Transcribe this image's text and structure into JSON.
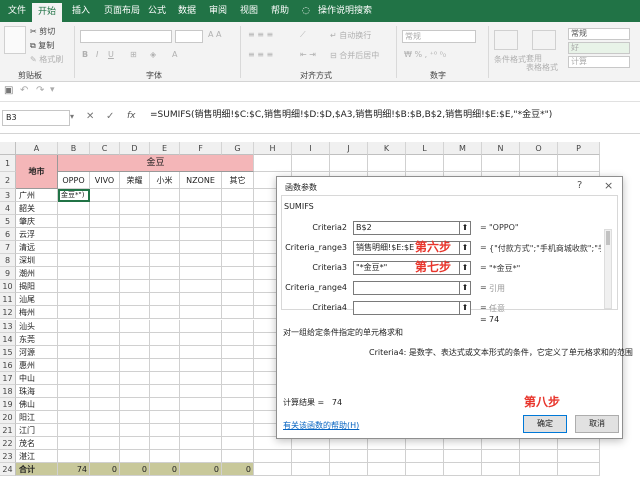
{
  "tabs": [
    "文件",
    "开始",
    "插入",
    "页面布局",
    "公式",
    "数据",
    "审阅",
    "视图",
    "帮助"
  ],
  "tell_me": "操作说明搜索",
  "ribbon": {
    "clipboard": {
      "cut": "剪切",
      "copy": "复制",
      "format_painter": "格式刷",
      "label": "剪贴板"
    },
    "font": {
      "label": "字体"
    },
    "align": {
      "wrap": "自动换行",
      "merge": "合并后居中",
      "label": "对齐方式"
    },
    "number": {
      "format": "常规",
      "label": "数字"
    },
    "styles": {
      "cond": "条件格式",
      "table": "套用\n表格格式",
      "normal": "常规",
      "good": "好",
      "calc": "计算"
    }
  },
  "formula_bar": {
    "name_box": "B3",
    "formula": "=SUMIFS(销售明细!$C:$C,销售明细!$D:$D,$A3,销售明细!$B:$B,B$2,销售明细!$E:$E,\"*金豆*\")"
  },
  "sheet": {
    "columns": [
      "A",
      "B",
      "C",
      "D",
      "E",
      "F",
      "G",
      "H",
      "I",
      "J",
      "K",
      "L",
      "M",
      "N",
      "O",
      "P"
    ],
    "rows": [
      "1",
      "2",
      "3",
      "4",
      "5",
      "6",
      "7",
      "8",
      "9",
      "10",
      "11",
      "12",
      "13",
      "14",
      "15",
      "16",
      "17",
      "18",
      "19",
      "20",
      "21",
      "22",
      "23",
      "24"
    ],
    "header_city": "地市",
    "header_group": "金豆",
    "header_channels": [
      "OPPO",
      "VIVO",
      "荣耀",
      "小米",
      "NZONE",
      "其它"
    ],
    "b3_text": "金豆*\")",
    "cities": [
      "广州",
      "韶关",
      "肇庆",
      "云浮",
      "清远",
      "深圳",
      "潮州",
      "揭阳",
      "汕尾",
      "梅州",
      "汕头",
      "东莞",
      "河源",
      "惠州",
      "中山",
      "珠海",
      "佛山",
      "阳江",
      "江门",
      "茂名",
      "湛江"
    ],
    "total_label": "合计",
    "totals": [
      "74",
      "0",
      "0",
      "0",
      "0",
      "0"
    ]
  },
  "dialog": {
    "title": "函数参数",
    "help_icon": "?",
    "close_icon": "×",
    "func": "SUMIFS",
    "args": [
      {
        "label": "Criteria2",
        "value": "B$2",
        "result": "\"OPPO\"",
        "step": ""
      },
      {
        "label": "Criteria_range3",
        "value": "销售明细!$E:$E",
        "result": "{\"付款方式\";\"手机商城收款\";\"手机",
        "step": "第六步"
      },
      {
        "label": "Criteria3",
        "value": "\"*金豆*\"",
        "result": "\"*金豆*\"",
        "step": "第七步"
      },
      {
        "label": "Criteria_range4",
        "value": "",
        "result": "引用",
        "step": ""
      },
      {
        "label": "Criteria4",
        "value": "",
        "result": "任意",
        "step": ""
      }
    ],
    "eq": "=",
    "total_result": "74",
    "description": "对一组给定条件指定的单元格求和",
    "arg_desc": "Criteria4:  是数字、表达式或文本形式的条件，它定义了单元格求和的范围",
    "calc_result": "计算结果 =   74",
    "step8": "第八步",
    "help_link": "有关该函数的帮助(H)",
    "ok": "确定",
    "cancel": "取消"
  }
}
